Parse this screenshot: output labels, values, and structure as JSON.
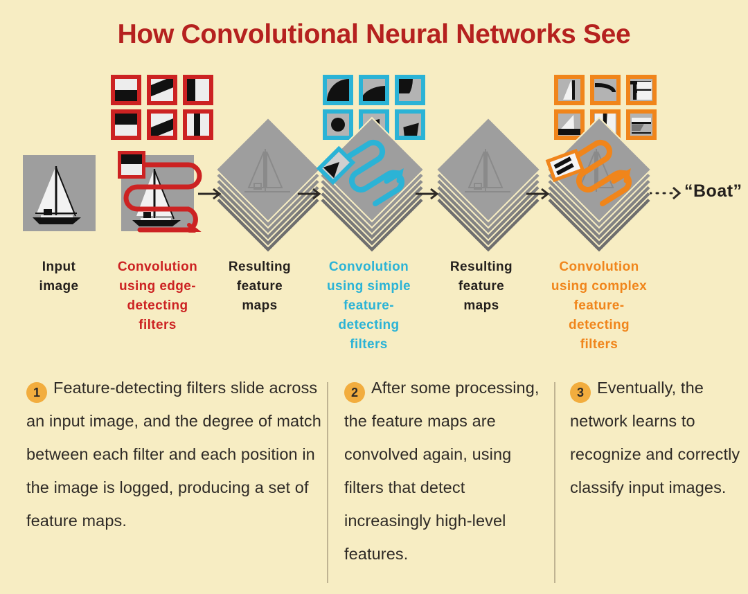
{
  "title": "How Convolutional Neural Networks See",
  "colors": {
    "background": "#f7edc3",
    "title_red": "#b5211f",
    "red": "#cc2222",
    "cyan": "#2bb3d6",
    "orange": "#f0851b",
    "badge": "#f2ad3e",
    "dark_text": "#231f1c",
    "panel_gray": "#9e9e9e"
  },
  "pipeline": {
    "stages": [
      {
        "id": "input-image",
        "label": "Input\nimage",
        "label_color": "dark"
      },
      {
        "id": "conv-edge",
        "label": "Convolution\nusing edge-\ndetecting\nfilters",
        "label_color": "red"
      },
      {
        "id": "feature-maps-1",
        "label": "Resulting\nfeature\nmaps",
        "label_color": "dark"
      },
      {
        "id": "conv-simple",
        "label": "Convolution\nusing simple\nfeature-\ndetecting\nfilters",
        "label_color": "cyan"
      },
      {
        "id": "feature-maps-2",
        "label": "Resulting\nfeature\nmaps",
        "label_color": "dark"
      },
      {
        "id": "conv-complex",
        "label": "Convolution\nusing complex\nfeature-\ndetecting\nfilters",
        "label_color": "orange"
      }
    ],
    "output_label": "“Boat”",
    "filter_banks": [
      {
        "id": "edge-filters",
        "color": "red",
        "count": 6,
        "kinds": [
          "horizontal-edge",
          "diagonal-edge",
          "vertical-edge",
          "horizontal-edge",
          "diagonal-edge",
          "vertical-edge"
        ]
      },
      {
        "id": "simple-filters",
        "color": "cyan",
        "count": 6,
        "kinds": [
          "quarter-curve",
          "arc-curve",
          "hook-curve",
          "circle",
          "wedge",
          "slope"
        ]
      },
      {
        "id": "complex-filters",
        "color": "orange",
        "count": 6,
        "kinds": [
          "sail",
          "bow-curve",
          "mast-joint",
          "sail-hull",
          "twin-mast",
          "hull"
        ]
      }
    ],
    "stack_layers": 6
  },
  "captions": [
    {
      "number": "1",
      "text": "Feature-detecting filters slide across an input image, and the degree of match between each filter and each position in the image is logged, producing a set of feature maps."
    },
    {
      "number": "2",
      "text": "After some processing, the feature maps are convolved again, using filters that detect increasingly high-level features."
    },
    {
      "number": "3",
      "text": "Eventually, the network learns to recognize and correctly classify input images."
    }
  ]
}
